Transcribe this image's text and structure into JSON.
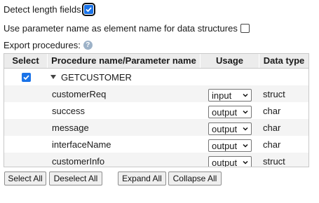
{
  "options": {
    "detect_length_label": "Detect length fields",
    "detect_length_checked": true,
    "use_param_name_label": "Use parameter name as element name for data structures",
    "use_param_name_checked": false,
    "export_label": "Export procedures:",
    "help_glyph": "?"
  },
  "grid": {
    "columns": [
      "Select",
      "Procedure name/Parameter name",
      "Usage",
      "Data type"
    ],
    "procedure": {
      "name": "GETCUSTOMER",
      "selected": true,
      "expanded": true
    },
    "parameters": [
      {
        "name": "customerReq",
        "usage": "input",
        "type": "struct"
      },
      {
        "name": "success",
        "usage": "output",
        "type": "char"
      },
      {
        "name": "message",
        "usage": "output",
        "type": "char"
      },
      {
        "name": "interfaceName",
        "usage": "output",
        "type": "char"
      },
      {
        "name": "customerInfo",
        "usage": "output",
        "type": "struct"
      }
    ]
  },
  "buttons": {
    "select_all": "Select All",
    "deselect_all": "Deselect All",
    "expand_all": "Expand All",
    "collapse_all": "Collapse All"
  },
  "colors": {
    "accent": "#1a73e8",
    "header_bg": "#ececec",
    "help_icon": "#9db2c8"
  }
}
